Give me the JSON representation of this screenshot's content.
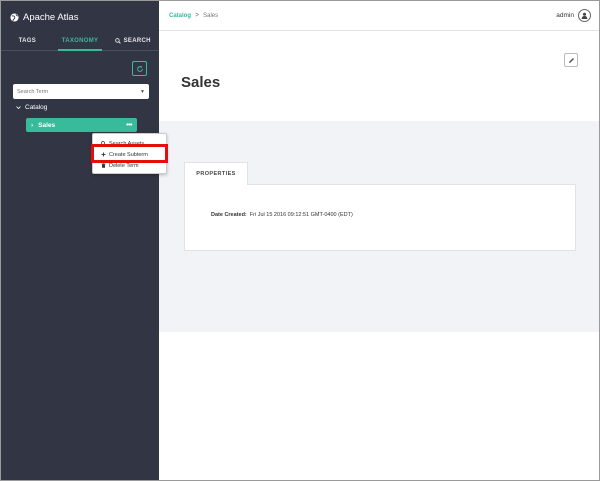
{
  "app": {
    "title": "Apache Atlas"
  },
  "sidebar": {
    "tabs": [
      {
        "label": "TAGS",
        "active": false
      },
      {
        "label": "TAXONOMY",
        "active": true
      },
      {
        "label": "SEARCH",
        "icon": "search-icon",
        "active": false
      }
    ],
    "search_placeholder": "Search Term",
    "tree": {
      "root": "Catalog",
      "selected": "Sales"
    }
  },
  "context_menu": {
    "items": [
      {
        "label": "Search Assets",
        "icon": "search-icon"
      },
      {
        "label": "Create Subterm",
        "icon": "plus-icon",
        "highlighted": true
      },
      {
        "label": "Delete Term",
        "icon": "trash-icon"
      }
    ]
  },
  "header": {
    "breadcrumb": {
      "parent": "Catalog",
      "separator": ">",
      "current": "Sales"
    },
    "user": "admin"
  },
  "main": {
    "title": "Sales",
    "properties_tab": "PROPERTIES",
    "properties": [
      {
        "label": "Date Created:",
        "value": "Fri Jul 15 2016 09:12:51 GMT-0400 (EDT)"
      }
    ]
  },
  "colors": {
    "sidebar_bg": "#323544",
    "accent": "#37bb9b",
    "highlight_border": "#e01010",
    "content_bg": "#f2f3f7"
  }
}
